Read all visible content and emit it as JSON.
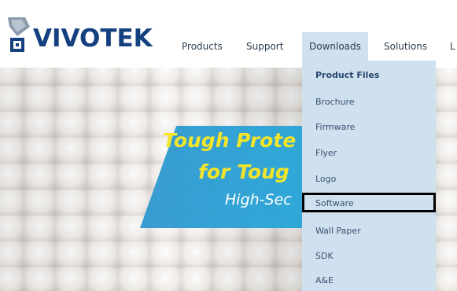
{
  "brand": {
    "name": "VIVOTEK",
    "logo_icon": "camera-logo-icon"
  },
  "nav": {
    "items": [
      {
        "label": "Products"
      },
      {
        "label": "Support"
      },
      {
        "label": "Downloads",
        "active": true
      },
      {
        "label": "Solutions"
      },
      {
        "label": "L"
      }
    ]
  },
  "downloads_menu": {
    "items": [
      {
        "label": "Product Files"
      },
      {
        "label": "Brochure"
      },
      {
        "label": "Firmware"
      },
      {
        "label": "Flyer"
      },
      {
        "label": "Logo"
      },
      {
        "label": "Software",
        "highlighted": true
      },
      {
        "label": "Wall Paper"
      },
      {
        "label": "SDK"
      },
      {
        "label": "A&E"
      }
    ]
  },
  "hero": {
    "line1": "Tough Prote",
    "line2": "for Toug",
    "line3": "High-Sec"
  },
  "colors": {
    "brand_blue": "#14407f",
    "menu_bg": "#cfe0ee",
    "banner_blue": "#27a5d8",
    "banner_yellow": "#f2e52a",
    "highlight_border": "#000000"
  }
}
